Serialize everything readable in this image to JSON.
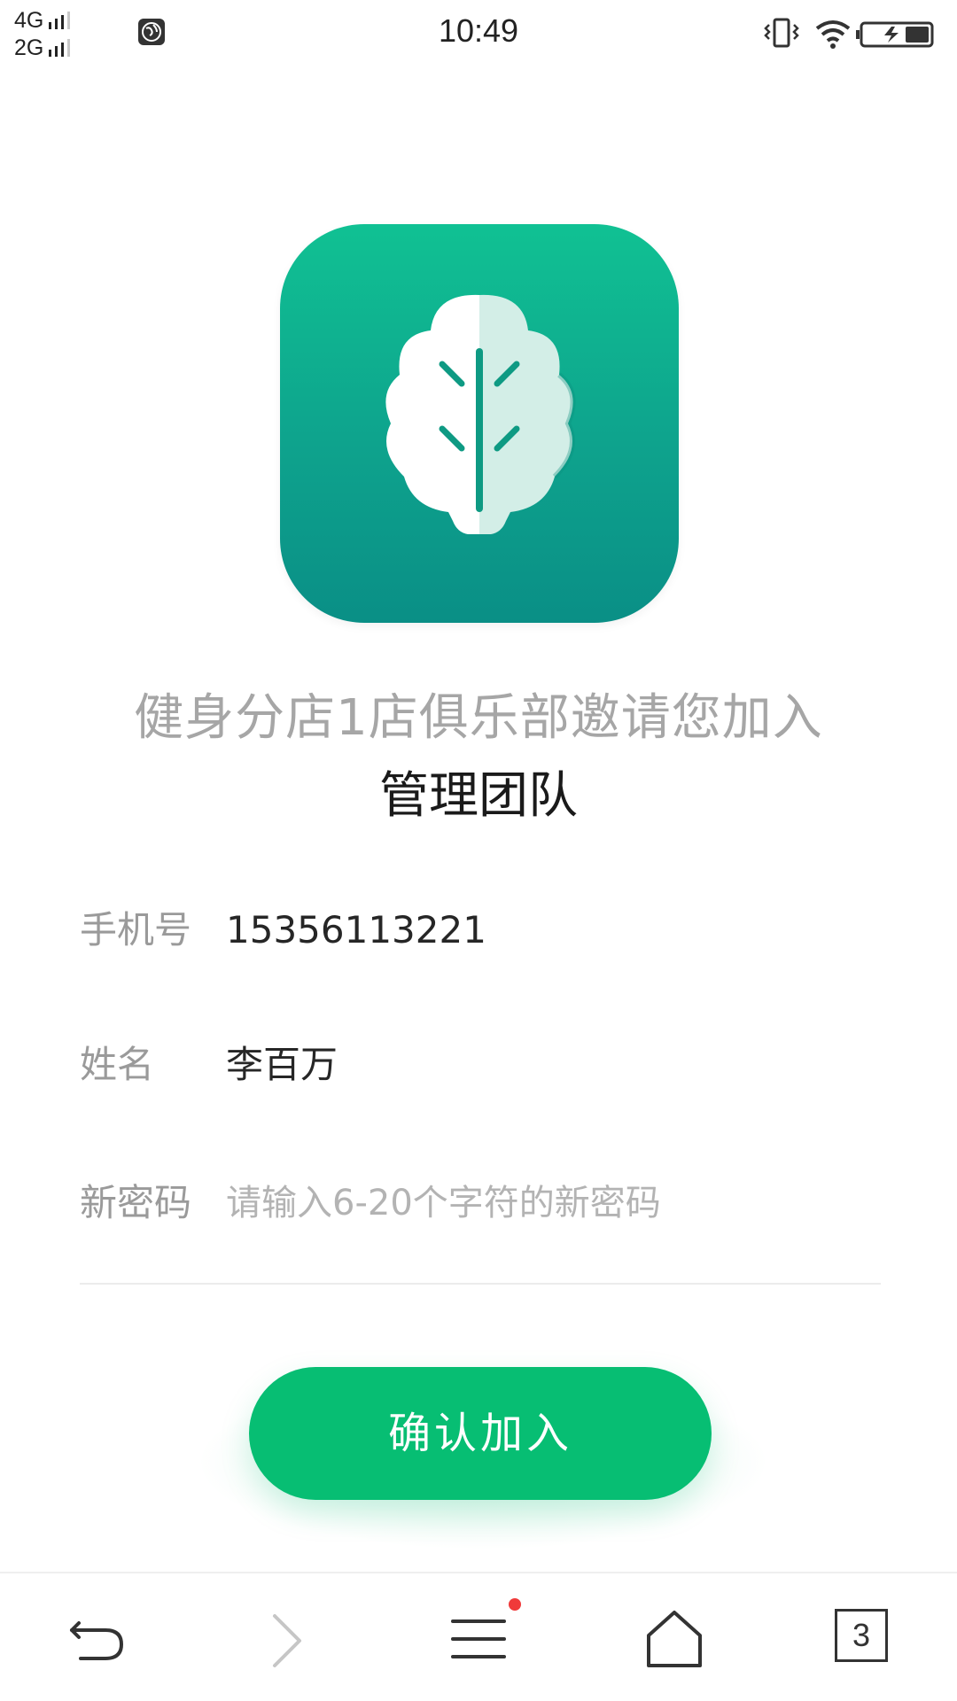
{
  "status_bar": {
    "network_1": "4G",
    "network_2": "2G",
    "time": "10:49",
    "icons": [
      "signal-bars-icon",
      "globe-icon",
      "vibrate-icon",
      "wifi-icon",
      "battery-charging-icon"
    ]
  },
  "app": {
    "icon": "leaf-app-icon",
    "colors": {
      "icon_top": "#10c193",
      "icon_bottom": "#0a8f86"
    }
  },
  "invite": {
    "line1": "健身分店1店俱乐部邀请您加入",
    "line2": "管理团队"
  },
  "form": {
    "phone": {
      "label": "手机号",
      "value": "15356113221"
    },
    "name": {
      "label": "姓名",
      "value": "李百万"
    },
    "password": {
      "label": "新密码",
      "placeholder": "请输入6-20个字符的新密码",
      "value": ""
    }
  },
  "confirm_button": {
    "label": "确认加入",
    "color": "#07be73"
  },
  "browser_bar": {
    "items": [
      "back-icon",
      "forward-icon",
      "menu-icon",
      "home-icon",
      "tabs-icon"
    ],
    "tabs_count": "3",
    "menu_badge_color": "#f03a3a"
  }
}
